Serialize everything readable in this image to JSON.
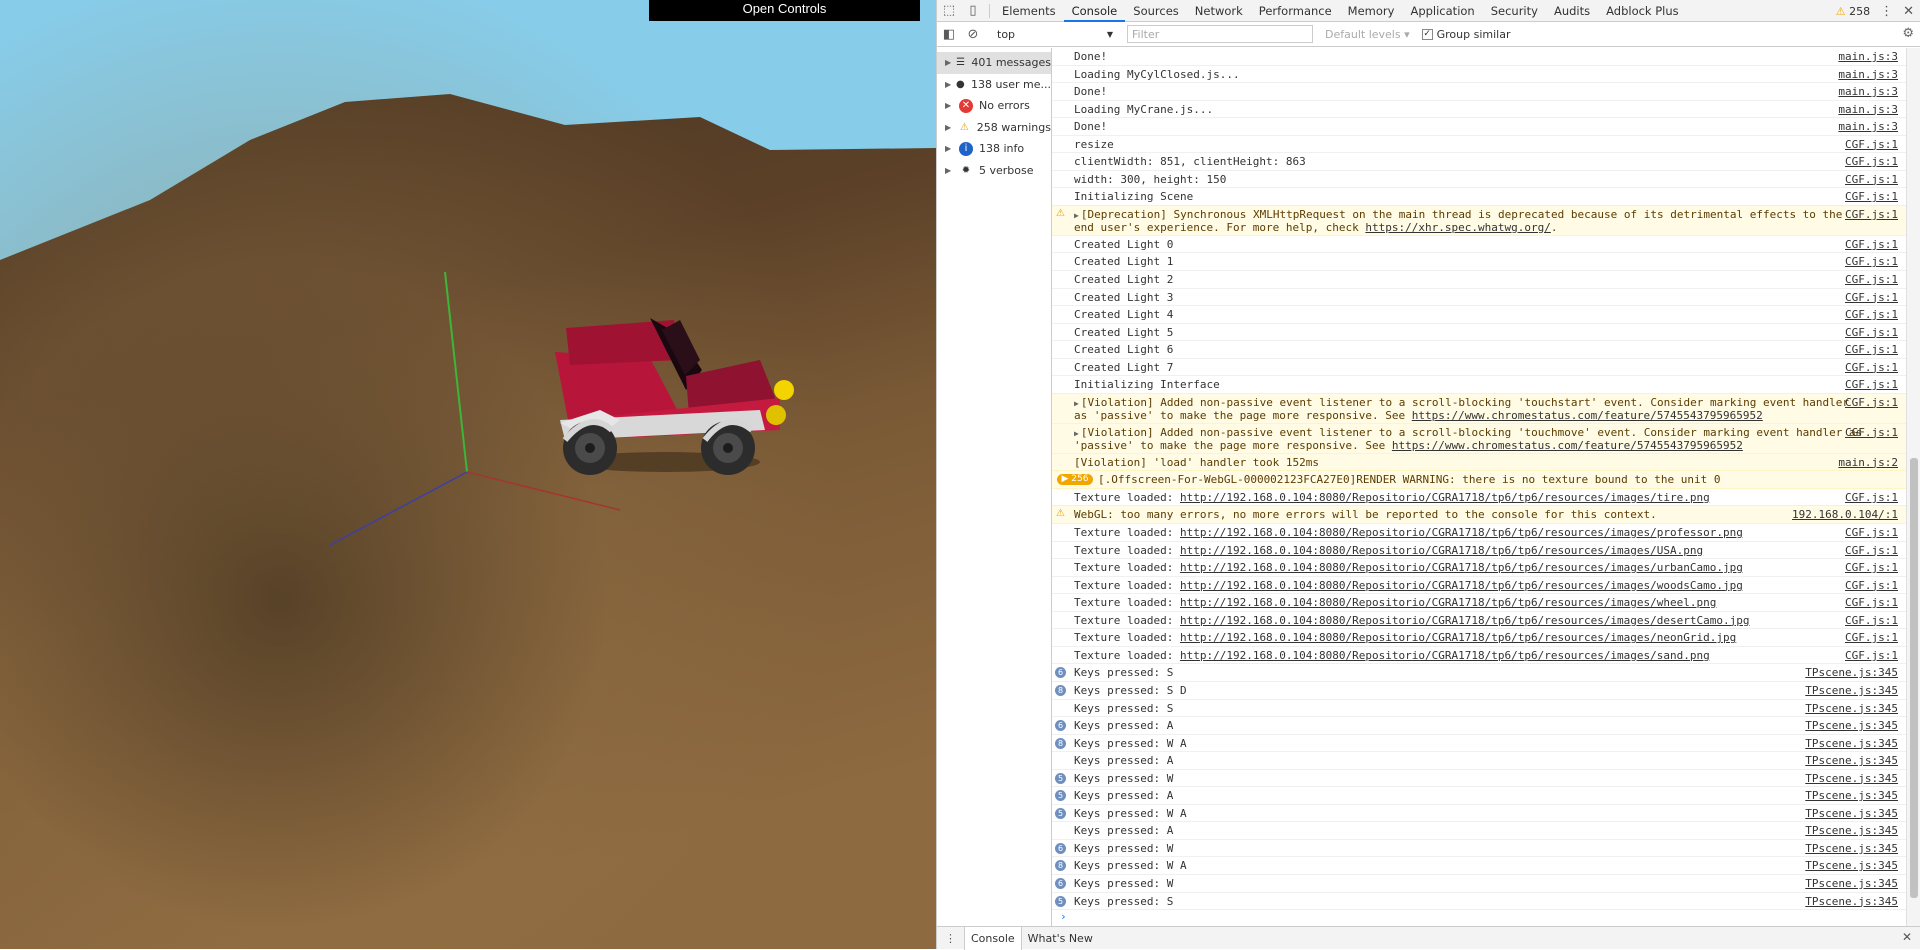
{
  "scene": {
    "open_controls_label": "Open Controls"
  },
  "devtools": {
    "tabs": [
      "Elements",
      "Console",
      "Sources",
      "Network",
      "Performance",
      "Memory",
      "Application",
      "Security",
      "Audits",
      "Adblock Plus"
    ],
    "active_tab": "Console",
    "warning_count": "258",
    "toolbar": {
      "context": "top",
      "filter_placeholder": "Filter",
      "levels": "Default levels ▾",
      "group_similar": "Group similar",
      "group_similar_checked": true
    },
    "sidebar": [
      {
        "label": "401 messages",
        "icon": "list-icon"
      },
      {
        "label": "138 user me...",
        "icon": "user-icon"
      },
      {
        "label": "No errors",
        "icon": "error-icon"
      },
      {
        "label": "258 warnings",
        "icon": "warning-icon"
      },
      {
        "label": "138 info",
        "icon": "info-icon"
      },
      {
        "label": "5 verbose",
        "icon": "bug-icon"
      }
    ],
    "log": [
      {
        "text": "Done!",
        "src": "main.js:3"
      },
      {
        "text": "Loading MyCylClosed.js...",
        "src": "main.js:3"
      },
      {
        "text": "Done!",
        "src": "main.js:3"
      },
      {
        "text": "Loading MyCrane.js...",
        "src": "main.js:3"
      },
      {
        "text": "Done!",
        "src": "main.js:3"
      },
      {
        "text": "resize",
        "src": "CGF.js:1"
      },
      {
        "text": "clientWidth: 851, clientHeight: 863",
        "src": "CGF.js:1"
      },
      {
        "text": "width: 300, height: 150",
        "src": "CGF.js:1"
      },
      {
        "text": "Initializing Scene",
        "src": "CGF.js:1"
      },
      {
        "text": "[Deprecation] Synchronous XMLHttpRequest on the main thread is deprecated because of its detrimental effects to the end user's experience. For more help, check ",
        "link": "https://xhr.spec.whatwg.org/",
        "after": ".",
        "src": "CGF.js:1",
        "level": "warn",
        "expand": true
      },
      {
        "text": "Created Light 0",
        "src": "CGF.js:1"
      },
      {
        "text": "Created Light 1",
        "src": "CGF.js:1"
      },
      {
        "text": "Created Light 2",
        "src": "CGF.js:1"
      },
      {
        "text": "Created Light 3",
        "src": "CGF.js:1"
      },
      {
        "text": "Created Light 4",
        "src": "CGF.js:1"
      },
      {
        "text": "Created Light 5",
        "src": "CGF.js:1"
      },
      {
        "text": "Created Light 6",
        "src": "CGF.js:1"
      },
      {
        "text": "Created Light 7",
        "src": "CGF.js:1"
      },
      {
        "text": "Initializing Interface",
        "src": "CGF.js:1"
      },
      {
        "text": "[Violation] Added non-passive event listener to a scroll-blocking 'touchstart' event. Consider marking event handler as 'passive' to make the page more responsive. See ",
        "link": "https://www.chromestatus.com/feature/5745543795965952",
        "src": "CGF.js:1",
        "level": "verbose",
        "expand": true
      },
      {
        "text": "[Violation] Added non-passive event listener to a scroll-blocking 'touchmove' event. Consider marking event handler as 'passive' to make the page more responsive. See ",
        "link": "https://www.chromestatus.com/feature/5745543795965952",
        "src": "CGF.js:1",
        "level": "verbose",
        "expand": true
      },
      {
        "text": "[Violation] 'load' handler took 152ms",
        "src": "main.js:2",
        "level": "verbose"
      },
      {
        "text": "[.Offscreen-For-WebGL-000002123FCA27E0]RENDER WARNING: there is no texture bound to the unit 0",
        "src": "",
        "level": "warn",
        "count": "256"
      },
      {
        "text": "Texture loaded: ",
        "link": "http://192.168.0.104:8080/Repositorio/CGRA1718/tp6/tp6/resources/images/tire.png",
        "src": "CGF.js:1"
      },
      {
        "text": "WebGL: too many errors, no more errors will be reported to the console for this context.",
        "src": "192.168.0.104/:1",
        "level": "warn"
      },
      {
        "text": "Texture loaded: ",
        "link": "http://192.168.0.104:8080/Repositorio/CGRA1718/tp6/tp6/resources/images/professor.png",
        "src": "CGF.js:1"
      },
      {
        "text": "Texture loaded: ",
        "link": "http://192.168.0.104:8080/Repositorio/CGRA1718/tp6/tp6/resources/images/USA.png",
        "src": "CGF.js:1"
      },
      {
        "text": "Texture loaded: ",
        "link": "http://192.168.0.104:8080/Repositorio/CGRA1718/tp6/tp6/resources/images/urbanCamo.jpg",
        "src": "CGF.js:1"
      },
      {
        "text": "Texture loaded: ",
        "link": "http://192.168.0.104:8080/Repositorio/CGRA1718/tp6/tp6/resources/images/woodsCamo.jpg",
        "src": "CGF.js:1"
      },
      {
        "text": "Texture loaded: ",
        "link": "http://192.168.0.104:8080/Repositorio/CGRA1718/tp6/tp6/resources/images/wheel.png",
        "src": "CGF.js:1"
      },
      {
        "text": "Texture loaded: ",
        "link": "http://192.168.0.104:8080/Repositorio/CGRA1718/tp6/tp6/resources/images/desertCamo.jpg",
        "src": "CGF.js:1"
      },
      {
        "text": "Texture loaded: ",
        "link": "http://192.168.0.104:8080/Repositorio/CGRA1718/tp6/tp6/resources/images/neonGrid.jpg",
        "src": "CGF.js:1"
      },
      {
        "text": "Texture loaded: ",
        "link": "http://192.168.0.104:8080/Repositorio/CGRA1718/tp6/tp6/resources/images/sand.png",
        "src": "CGF.js:1"
      },
      {
        "text": "Keys pressed:  S",
        "src": "TPscene.js:345",
        "count": "6"
      },
      {
        "text": "Keys pressed:  S  D",
        "src": "TPscene.js:345",
        "count": "8"
      },
      {
        "text": "Keys pressed:  S",
        "src": "TPscene.js:345"
      },
      {
        "text": "Keys pressed:  A",
        "src": "TPscene.js:345",
        "count": "6"
      },
      {
        "text": "Keys pressed:  W  A",
        "src": "TPscene.js:345",
        "count": "8"
      },
      {
        "text": "Keys pressed:  A",
        "src": "TPscene.js:345"
      },
      {
        "text": "Keys pressed:  W",
        "src": "TPscene.js:345",
        "count": "5"
      },
      {
        "text": "Keys pressed:  A",
        "src": "TPscene.js:345",
        "count": "5"
      },
      {
        "text": "Keys pressed:  W  A",
        "src": "TPscene.js:345",
        "count": "5"
      },
      {
        "text": "Keys pressed:  A",
        "src": "TPscene.js:345"
      },
      {
        "text": "Keys pressed:  W",
        "src": "TPscene.js:345",
        "count": "6"
      },
      {
        "text": "Keys pressed:  W  A",
        "src": "TPscene.js:345",
        "count": "8"
      },
      {
        "text": "Keys pressed:  W",
        "src": "TPscene.js:345",
        "count": "6"
      },
      {
        "text": "Keys pressed:  S",
        "src": "TPscene.js:345",
        "count": "5"
      }
    ],
    "prompt": "›",
    "drawer": {
      "tabs": [
        "Console",
        "What's New"
      ],
      "active": "Console"
    }
  }
}
